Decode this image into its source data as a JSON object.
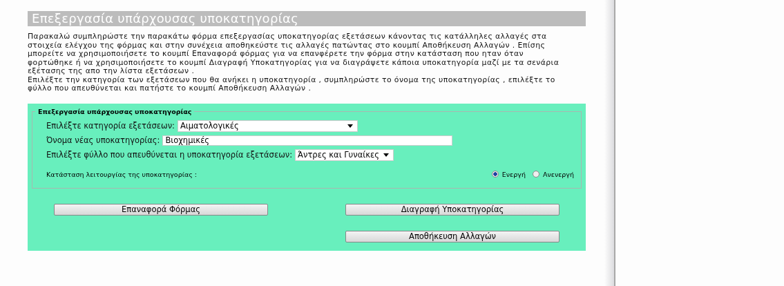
{
  "page_title": "Επεξεργασία υπάρχουσας υποκατηγορίας",
  "instructions": [
    "Παρακαλώ συμπληρώστε την παρακάτω φόρμα επεξεργασίας υποκατηγορίας εξετάσεων κάνοντας τις κατάλληλες αλλαγές στα στοιχεία ελέγχου της φόρμας και στην συνέχεια αποθηκεύστε τις αλλαγές πατώντας στο κουμπί Αποθήκευση Αλλαγών . Επίσης μπορείτε να χρησιμοποιήσετε το κουμπί Επαναφορά φόρμας για να επανφέρετε την φόρμα στην κατάσταση που ηταν όταν φορτώθηκε ή να χρησιμοποιήσετε το κουμπί Διαγραφή Υποκατηγορίας για να διαγράψετε κάποια υποκατηγορία μαζί με τα σενάρια εξέτασης της απο την λίστα εξετάσεων .",
    "Επιλέξτε την κατηγορία των εξετάσεων που θα ανήκει η υποκατηγορία , συμπληρώστε το όνομα της υποκατηγορίας , επιλέξτε το φύλλο που απευθύνεται και πατήστε το κουμπί Αποθήκευση Αλλαγών ."
  ],
  "form": {
    "legend": "Επεξεργασία υπάρχουσας υποκατηγορίας",
    "fields": [
      {
        "kind": "select",
        "label": "Επιλέξτε κατηγορία εξετάσεων:",
        "value": "Αιματολογικές"
      },
      {
        "kind": "text",
        "label": "Όνομα νέας υποκατηγορίας:",
        "value": "Βιοχημικές"
      },
      {
        "kind": "select",
        "label": "Επιλέξτε φύλλο που απευθύνεται η υποκατηγορία εξετάσεων:",
        "value": "Άντρες και Γυναίκες"
      }
    ],
    "status": {
      "label": "Κατάσταση λειτουργίας της υποκατηγορίας :",
      "options": [
        {
          "label": "Ενεργή",
          "selected": true
        },
        {
          "label": "Ανενεργή",
          "selected": false
        }
      ]
    }
  },
  "button_columns": [
    [
      "Επαναφορά Φόρμας"
    ],
    [
      "Διαγραφή Υποκατηγορίας",
      "Αποθήκευση Αλλαγών"
    ]
  ]
}
